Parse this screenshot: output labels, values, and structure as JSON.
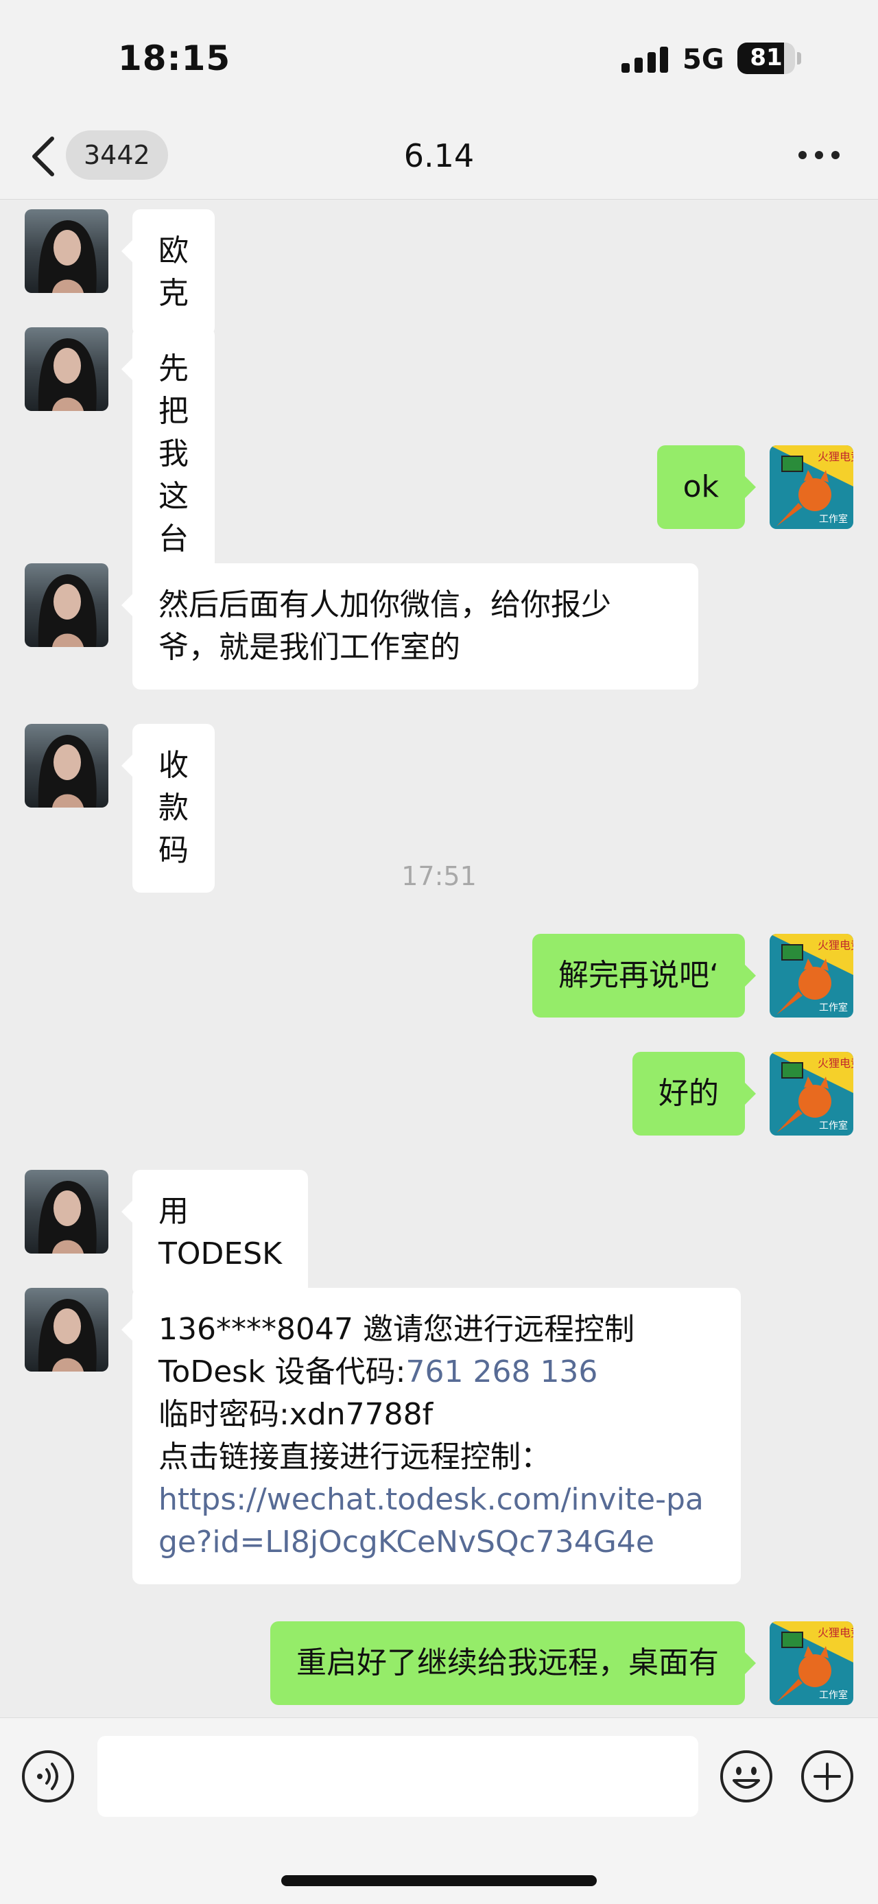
{
  "status_bar": {
    "time": "18:15",
    "network": "5G",
    "battery": "81",
    "battery_level": 0.81
  },
  "nav": {
    "back_badge": "3442",
    "title": "6.14"
  },
  "messages": [
    {
      "side": "in",
      "text": "欧克"
    },
    {
      "side": "in",
      "text": "先把我这台结了"
    },
    {
      "side": "out",
      "text": "ok"
    },
    {
      "side": "in",
      "lines": [
        "然后后面有人加你微信，给你报少",
        "爷，就是我们工作室的"
      ]
    },
    {
      "side": "in",
      "text": "收款码"
    },
    {
      "type": "timestamp",
      "text": "17:51"
    },
    {
      "side": "out",
      "text": "解完再说吧‘"
    },
    {
      "side": "out",
      "text": "好的"
    },
    {
      "side": "in",
      "text": "用 TODESK"
    },
    {
      "side": "in",
      "invite": {
        "line1": "136****8047 邀请您进行远程控制",
        "code_label": "ToDesk 设备代码:",
        "code": "761 268 136",
        "password": "临时密码:xdn7788f",
        "link_label": "点击链接直接进行远程控制：",
        "link_line1": "https://wechat.todesk.com/invite-pa",
        "link_line2": "ge?id=LI8jOcgKCeNvSQc734G4e"
      }
    },
    {
      "side": "out",
      "text": "重启好了继续给我远程，桌面有"
    }
  ],
  "colors": {
    "outgoing": "#95ec69",
    "incoming": "#ffffff",
    "link": "#576b95",
    "background": "#ededed"
  },
  "icons": [
    "back-chevron-icon",
    "more-dots-icon",
    "voice-icon",
    "emoji-icon",
    "plus-icon",
    "signal-icon",
    "battery-icon"
  ]
}
